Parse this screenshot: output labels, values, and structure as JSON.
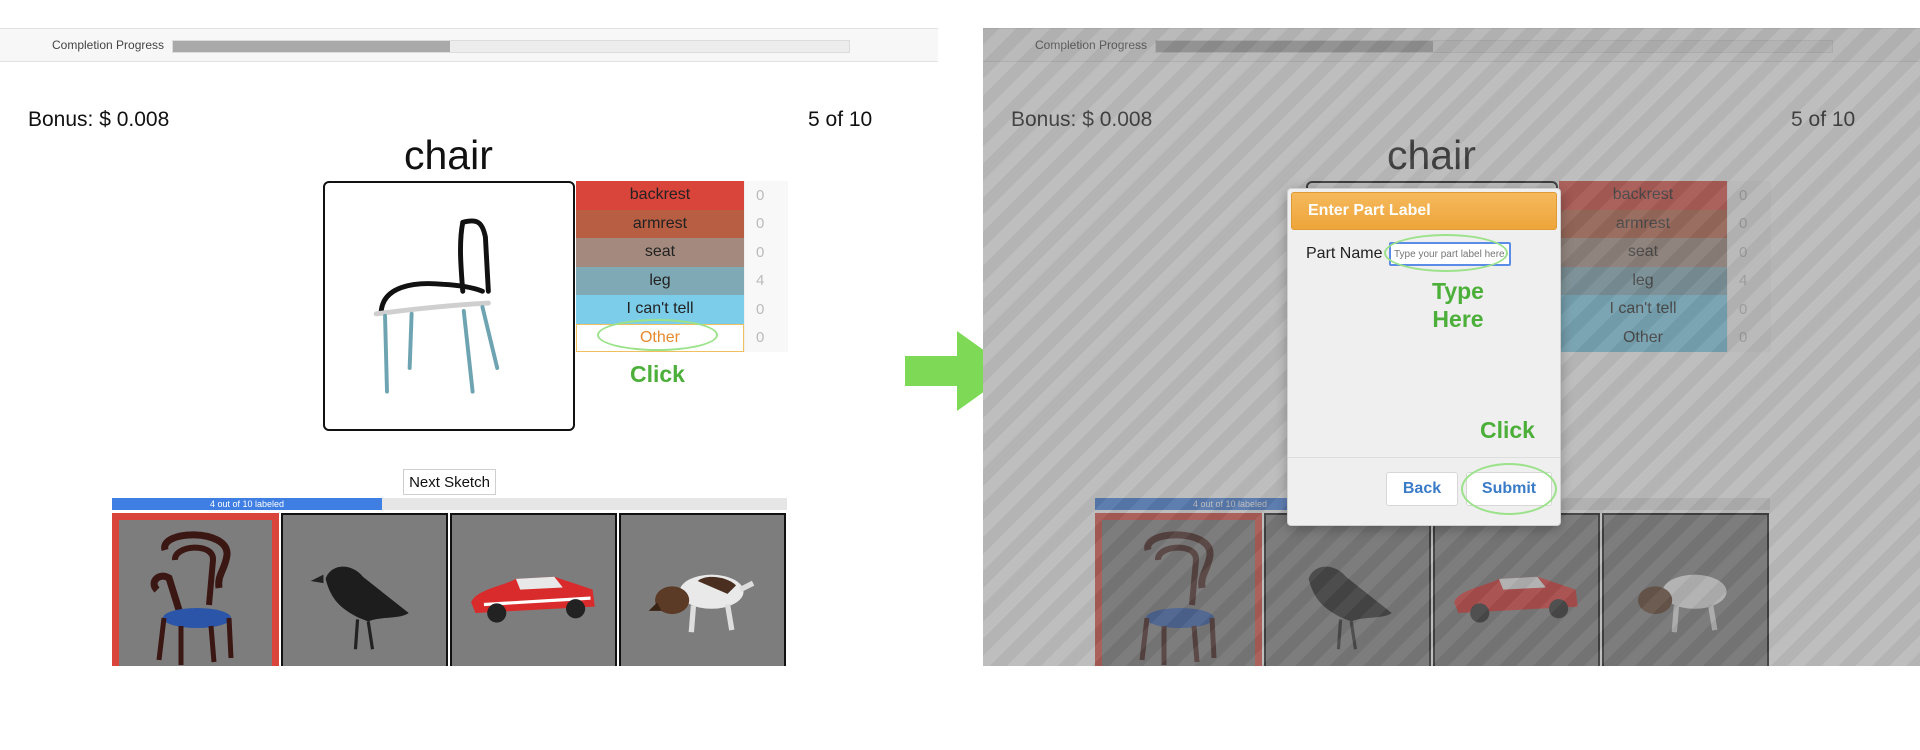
{
  "progress": {
    "label": "Completion Progress",
    "fraction": 0.41
  },
  "bonus": "Bonus: $ 0.008",
  "counter": "5 of 10",
  "category": "chair",
  "labels": [
    {
      "name": "backrest",
      "count": "0",
      "color": "#d9453b"
    },
    {
      "name": "armrest",
      "count": "0",
      "color": "#b75e43"
    },
    {
      "name": "seat",
      "count": "0",
      "color": "#a48a7e"
    },
    {
      "name": "leg",
      "count": "4",
      "color": "#7fa9b5"
    },
    {
      "name": "I can't tell",
      "count": "0",
      "color": "#7bcde9"
    },
    {
      "name": "Other",
      "count": "0",
      "color": "#ffffff"
    }
  ],
  "click_hint": "Click",
  "next_button": "Next Sketch",
  "gallery": {
    "progress_text": "4 out of 10 labeled",
    "fraction": 0.4,
    "thumbs": [
      "chair",
      "crow",
      "car",
      "dog"
    ]
  },
  "modal": {
    "title": "Enter Part Label",
    "field_label": "Part Name",
    "placeholder": "Type your part label here",
    "type_hint_line1": "Type",
    "type_hint_line2": "Here",
    "click_hint": "Click",
    "back": "Back",
    "submit": "Submit"
  },
  "colors": {
    "accent": "#3f7ee3",
    "hint": "#4caf3a",
    "modal_header": "#eea53a"
  }
}
